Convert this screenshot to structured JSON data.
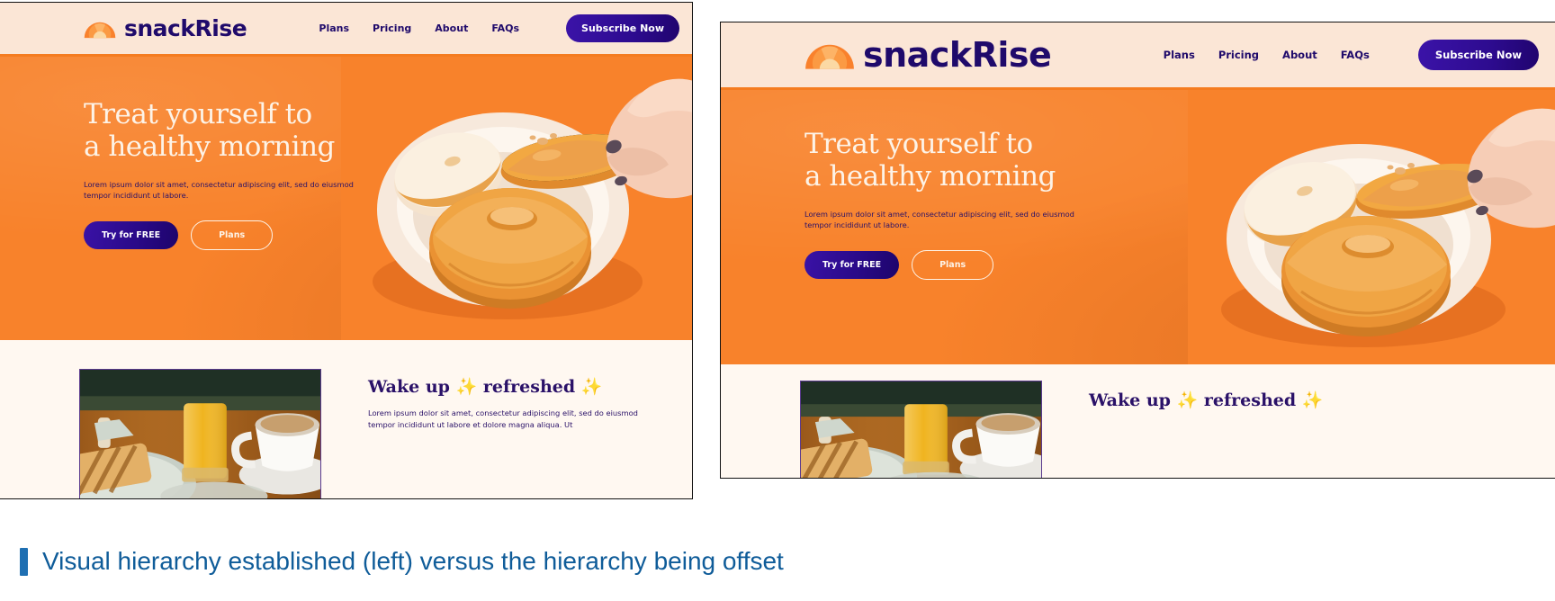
{
  "caption": {
    "text": "Visual hierarchy established (left) versus the hierarchy being offset",
    "accent_color": "#1f6fb2",
    "text_color": "#0f5c99"
  },
  "colors": {
    "page_bg": "#ffffff",
    "panel_bg": "#fff8f1",
    "nav_bg": "#fbe6d6",
    "hero_orange": "#f8822b",
    "brand_navy": "#1f0a6b",
    "cta_purple": "#2d0b8f",
    "cream": "#fdf3e7",
    "sparkle_gold": "#f9c440",
    "panel_border": "#111111",
    "thumb_border": "#5b3a8e"
  },
  "panels": [
    {
      "id": "left-panel",
      "variant": "established",
      "nav": {
        "logo_icon": "sunrise-fan-icon",
        "brand": "snackRise",
        "links": [
          "Plans",
          "Pricing",
          "About",
          "FAQs"
        ],
        "cta": "Subscribe Now"
      },
      "hero": {
        "title_line1": "Treat yourself to",
        "title_line2": "a healthy morning",
        "subtitle": "Lorem ipsum dolor sit amet, consectetur adipiscing elit, sed do eiusmod tempor incididunt ut labore.",
        "primary_cta": "Try for FREE",
        "secondary_cta": "Plans",
        "image_alt": "hand-reaching-for-bagel-on-plate"
      },
      "lower": {
        "image_alt": "breakfast-toast-orange-juice-coffee",
        "title_before": "Wake up ",
        "sparkle1": "✨",
        "title_middle": " refreshed ",
        "sparkle2": "✨",
        "subtitle": "Lorem ipsum dolor sit amet, consectetur adipiscing elit, sed do eiusmod tempor incididunt ut labore et dolore magna aliqua. Ut"
      }
    },
    {
      "id": "right-panel",
      "variant": "offset",
      "nav": {
        "logo_icon": "sunrise-fan-icon",
        "brand": "snackRise",
        "links": [
          "Plans",
          "Pricing",
          "About",
          "FAQs"
        ],
        "cta": "Subscribe Now"
      },
      "hero": {
        "title_line1": "Treat yourself to",
        "title_line2": "a healthy morning",
        "subtitle": "Lorem ipsum dolor sit amet, consectetur adipiscing elit, sed do eiusmod tempor incididunt ut labore.",
        "primary_cta": "Try for FREE",
        "secondary_cta": "Plans",
        "image_alt": "hand-reaching-for-bagel-on-plate"
      },
      "lower": {
        "image_alt": "breakfast-toast-orange-juice-coffee",
        "title_before": "Wake up ",
        "sparkle1": "✨",
        "title_middle": " refreshed ",
        "sparkle2": "✨",
        "subtitle": ""
      }
    }
  ]
}
